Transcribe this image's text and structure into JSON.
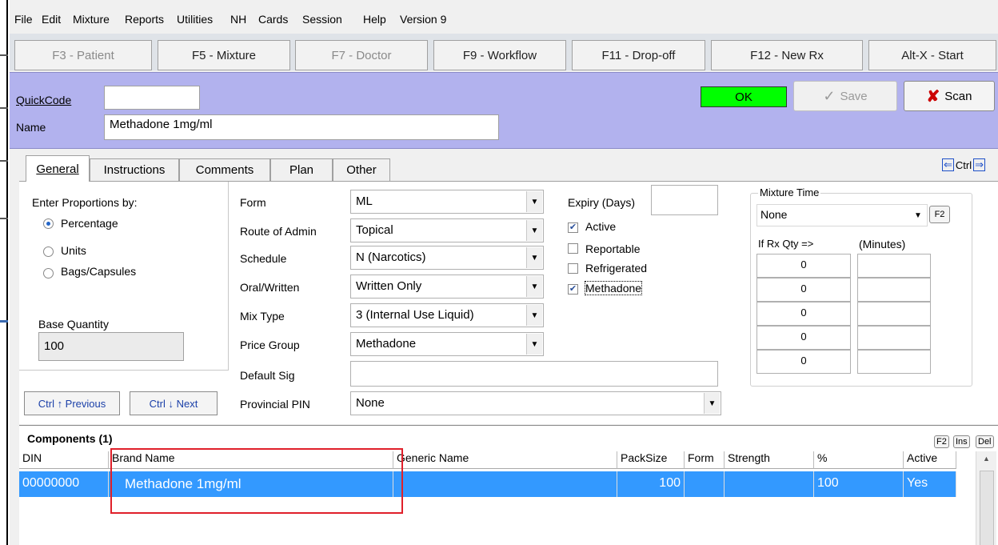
{
  "menu": [
    "File",
    "Edit",
    "Mixture",
    "Reports",
    "Utilities",
    "NH",
    "Cards",
    "Session",
    "Help",
    "Version 9"
  ],
  "fkeys": [
    {
      "label": "F3 - Patient",
      "enabled": false
    },
    {
      "label": "F5 - Mixture",
      "enabled": true
    },
    {
      "label": "F7 - Doctor",
      "enabled": false
    },
    {
      "label": "F9 - Workflow",
      "enabled": true
    },
    {
      "label": "F11 - Drop-off",
      "enabled": true
    },
    {
      "label": "F12 - New Rx",
      "enabled": true
    },
    {
      "label": "Alt-X - Start",
      "enabled": true
    }
  ],
  "header": {
    "quickcode_label": "QuickCode",
    "quickcode_value": "",
    "name_label": "Name",
    "name_value": "Methadone 1mg/ml",
    "ok": "OK",
    "save": "Save",
    "scan": "Scan"
  },
  "tabs": [
    "General",
    "Instructions",
    "Comments",
    "Plan",
    "Other"
  ],
  "tab_nav": "Ctrl",
  "general": {
    "proportions_label": "Enter Proportions by:",
    "proportion_options": [
      "Percentage",
      "Units",
      "Bags/Capsules"
    ],
    "selected_proportion": "Percentage",
    "base_quantity_label": "Base Quantity",
    "base_quantity": "100",
    "previous": "Ctrl ↑ Previous",
    "next": "Ctrl ↓ Next",
    "fields": [
      {
        "label": "Form",
        "value": "ML"
      },
      {
        "label": "Route of Admin",
        "value": "Topical"
      },
      {
        "label": "Schedule",
        "value": "N (Narcotics)"
      },
      {
        "label": "Oral/Written",
        "value": "Written Only"
      },
      {
        "label": "Mix Type",
        "value": "3 (Internal Use Liquid)"
      },
      {
        "label": "Price Group",
        "value": "Methadone"
      }
    ],
    "default_sig_label": "Default Sig",
    "default_sig": "",
    "provincial_pin_label": "Provincial PIN",
    "provincial_pin": "None",
    "expiry_label": "Expiry (Days)",
    "expiry": "",
    "checkboxes": [
      {
        "label": "Active",
        "checked": true
      },
      {
        "label": "Reportable",
        "checked": false
      },
      {
        "label": "Refrigerated",
        "checked": false
      },
      {
        "label": "Methadone",
        "checked": true
      }
    ],
    "mixture_time_label": "Mixture Time",
    "mixture_time": "None",
    "f2": "F2",
    "rx_qty_label": "If Rx Qty =>",
    "minutes_label": "(Minutes)",
    "rx_qty_values": [
      "0",
      "0",
      "0",
      "0",
      "0"
    ]
  },
  "components": {
    "title": "Components (1)",
    "keys": [
      "F2",
      "Ins",
      "Del"
    ],
    "columns": [
      "DIN",
      "Brand Name",
      "Generic Name",
      "PackSize",
      "Form",
      "Strength",
      "%",
      "Active"
    ],
    "rows": [
      {
        "din": "00000000",
        "brand": "Methadone 1mg/ml",
        "generic": "",
        "packsize": "100",
        "form": "",
        "strength": "",
        "percent": "100",
        "active": "Yes"
      }
    ]
  },
  "colors": {
    "header_bg": "#b2b2ee",
    "selection": "#3399ff",
    "ok_bg": "#00ff00",
    "highlight_box": "#e0202a"
  }
}
